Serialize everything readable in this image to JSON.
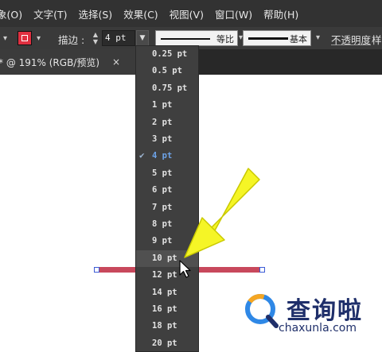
{
  "menubar": {
    "items": [
      "象(O)",
      "文字(T)",
      "选择(S)",
      "效果(C)",
      "视图(V)",
      "窗口(W)",
      "帮助(H)"
    ]
  },
  "controlbar": {
    "stroke_label": "描边 :",
    "weight_value": "4 pt",
    "profile_label": "等比",
    "brush_label": "基本",
    "opacity_label": "不透明度",
    "style_label": "样"
  },
  "tab": {
    "title": "* @ 191% (RGB/预览)",
    "close": "×"
  },
  "weight_dropdown": {
    "items": [
      "0.25 pt",
      "0.5 pt",
      "0.75 pt",
      "1 pt",
      "2 pt",
      "3 pt",
      "4 pt",
      "5 pt",
      "6 pt",
      "7 pt",
      "8 pt",
      "9 pt",
      "10 pt",
      "12 pt",
      "14 pt",
      "16 pt",
      "18 pt",
      "20 pt"
    ],
    "selected": "4 pt",
    "hovered": "10 pt"
  },
  "watermark": {
    "title": "查询啦",
    "url": "chaxunla.com"
  },
  "colors": {
    "stroke_swatch": "#e03040",
    "stroke_line": "#c8485c",
    "selected_item": "#6da3e8",
    "annotation_arrow": "#f5f526",
    "watermark_blue": "#1f2f6a",
    "watermark_accent": "#2f88e6"
  }
}
